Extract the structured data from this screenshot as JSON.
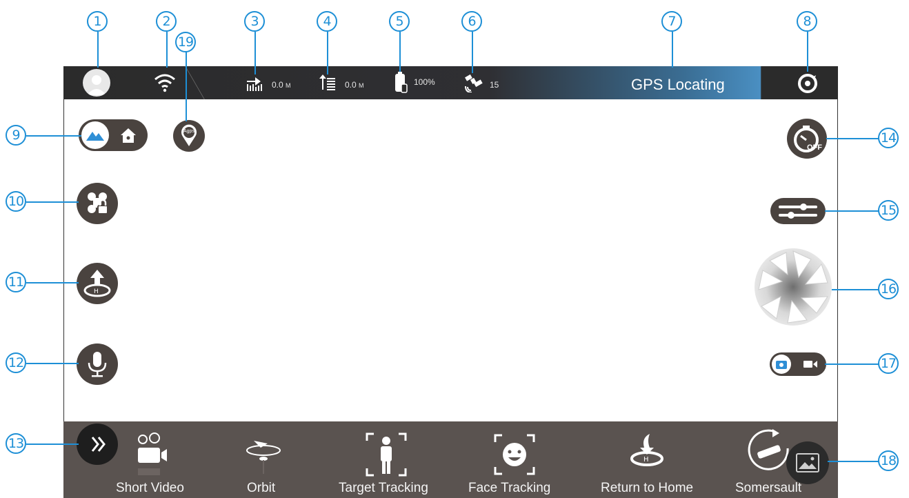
{
  "callouts": {
    "c1": "1",
    "c2": "2",
    "c3": "3",
    "c4": "4",
    "c5": "5",
    "c6": "6",
    "c7": "7",
    "c8": "8",
    "c9": "9",
    "c10": "10",
    "c11": "11",
    "c12": "12",
    "c13": "13",
    "c14": "14",
    "c15": "15",
    "c16": "16",
    "c17": "17",
    "c18": "18",
    "c19": "19"
  },
  "status_bar": {
    "distance_value": "0.0",
    "distance_unit": "M",
    "altitude_value": "0.0",
    "altitude_unit": "M",
    "battery": "100%",
    "satellites": "15",
    "gps_status": "GPS Locating"
  },
  "controls": {
    "agps_label": "Agps",
    "timer_label": "OFF"
  },
  "modes": [
    {
      "label": "Short Video"
    },
    {
      "label": "Orbit"
    },
    {
      "label": "Target Tracking"
    },
    {
      "label": "Face Tracking"
    },
    {
      "label": "Return to Home"
    },
    {
      "label": "Somersault"
    }
  ],
  "colors": {
    "callout": "#1d8fd6",
    "bar": "#2b2b2b",
    "gps_gradient": "#4a8fc2",
    "button": "#4a433f",
    "bottom_bar": "#5a5350"
  }
}
